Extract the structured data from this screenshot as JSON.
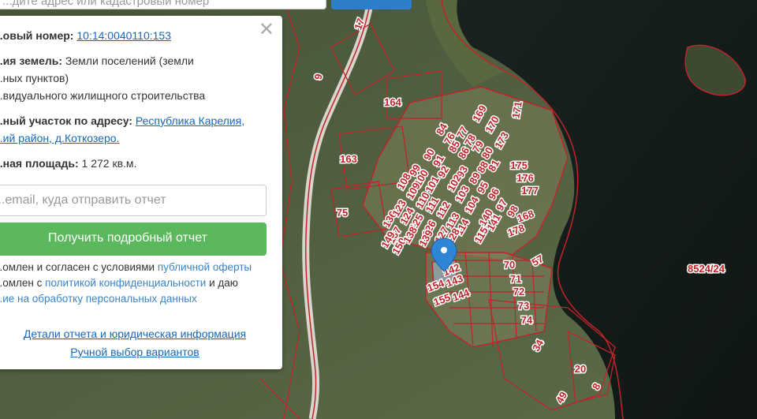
{
  "search": {
    "placeholder": "...дите адрес или кадастровый номер"
  },
  "info_panel": {
    "cadastral_label": "...овый номер:",
    "cadastral_value": "10:14:0040110:153",
    "category_label": "...ия земель:",
    "category_value_1": "Земли поселений (земли",
    "category_value_2": "...ных пунктов)",
    "category_value_3": "...видуального жилищного строительства",
    "address_label": "...ный участок по адресу:",
    "address_link_1": "Республика Карелия,",
    "address_link_2": "...ий район, д.Коткозеро.",
    "area_label": "...ная площадь:",
    "area_value": "1 272 кв.м.",
    "email_placeholder": "...email, куда отправить отчет",
    "report_button": "Получить подробный отчет",
    "terms_1a": "...омлен и согласен с условиями",
    "terms_1b": "публичной оферты",
    "terms_2a": "...омлен с",
    "terms_2b": "политикой конфиденциальности",
    "terms_2c": "и даю",
    "terms_3": "...ие на обработку персональных данных",
    "details_link": "Детали отчета и юридическая информация",
    "manual_link": "Ручной выбор вариантов"
  },
  "map": {
    "parcel_labels": [
      "17",
      "9",
      "164",
      "163",
      "75",
      "169",
      "171",
      "170",
      "84",
      "76",
      "85",
      "77",
      "173",
      "86",
      "78",
      "80",
      "79",
      "175",
      "176",
      "177",
      "88",
      "81",
      "89",
      "90",
      "108",
      "99",
      "100",
      "91",
      "101",
      "92",
      "93",
      "102",
      "109",
      "136",
      "123",
      "110",
      "124",
      "111",
      "125",
      "112",
      "103",
      "95",
      "96",
      "104",
      "113",
      "126",
      "97",
      "98",
      "139",
      "127",
      "114",
      "137",
      "149",
      "150",
      "138",
      "128",
      "115",
      "140",
      "141",
      "168",
      "178",
      "57",
      "70",
      "71",
      "72",
      "73",
      "74",
      "142",
      "143",
      "144",
      "154",
      "155",
      "34",
      "20",
      "8",
      "49"
    ],
    "area_label": "8524/24"
  },
  "colors": {
    "accent_green": "#5cb85c",
    "link_blue": "#1a66b5",
    "parcel_red": "#c0242a",
    "marker_blue": "#2f86d6"
  }
}
